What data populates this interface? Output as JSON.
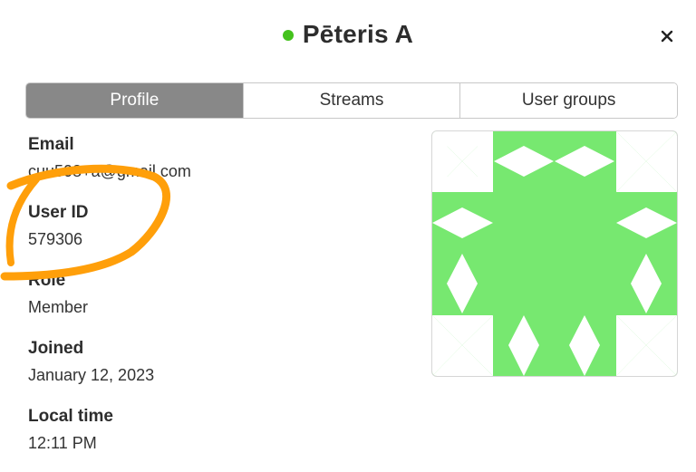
{
  "header": {
    "user_name": "Pēteris A",
    "status_color": "#44c21d",
    "close_icon": "close-icon"
  },
  "tabs": [
    {
      "label": "Profile",
      "active": true
    },
    {
      "label": "Streams",
      "active": false
    },
    {
      "label": "User groups",
      "active": false
    }
  ],
  "fields": [
    {
      "label": "Email",
      "value": "cuu508+a@gmail.com"
    },
    {
      "label": "User ID",
      "value": "579306"
    },
    {
      "label": "Role",
      "value": "Member"
    },
    {
      "label": "Joined",
      "value": "January 12, 2023"
    },
    {
      "label": "Local time",
      "value": "12:11 PM"
    }
  ],
  "avatar": {
    "icon": "identicon-avatar",
    "color": "#77e870"
  },
  "annotation": {
    "color": "#ff9f0a"
  }
}
